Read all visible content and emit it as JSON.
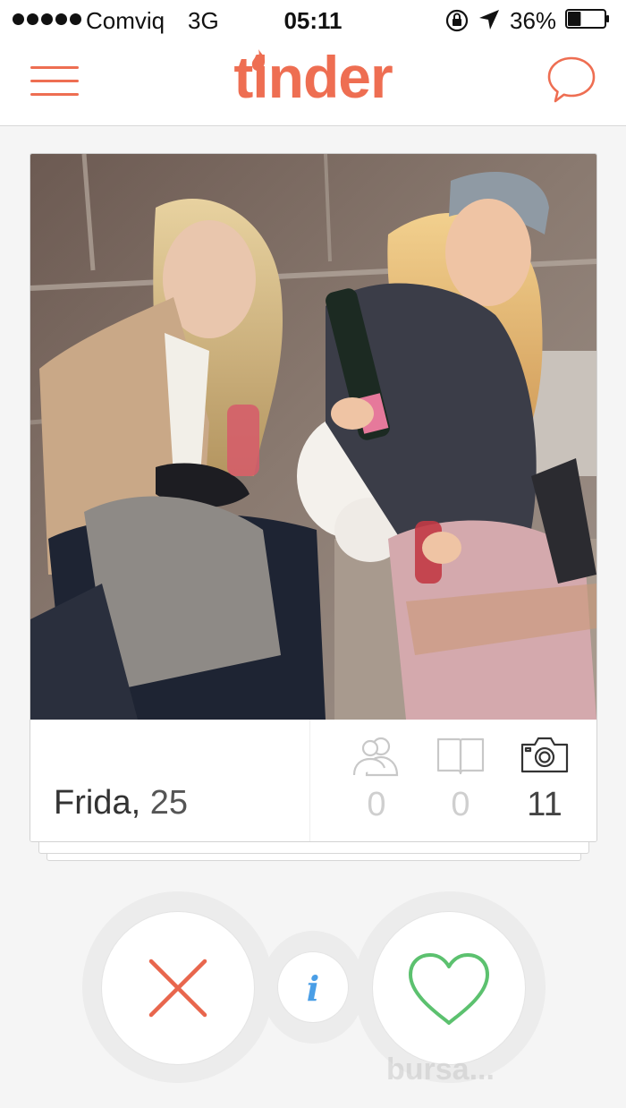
{
  "status_bar": {
    "carrier": "Comviq",
    "network": "3G",
    "time": "05:11",
    "battery_percent": "36%",
    "battery_level": 0.36,
    "icons": [
      "signal-dots-icon",
      "rotation-lock-icon",
      "location-arrow-icon",
      "battery-icon"
    ]
  },
  "nav": {
    "logo": "tinder",
    "menu_icon": "hamburger-menu-icon",
    "chat_icon": "chat-bubble-icon",
    "accent_color": "#ee6e52"
  },
  "card": {
    "name": "Frida,",
    "age": "25",
    "stats": {
      "shared_friends": "0",
      "shared_interests": "0",
      "photos": "11"
    },
    "stat_icons": [
      "friends-icon",
      "book-icon",
      "camera-icon"
    ],
    "photo_description_icon": "profile-photo"
  },
  "actions": {
    "nope_icon": "x-icon",
    "info_label": "i",
    "like_icon": "heart-icon",
    "nope_color": "#e8664d",
    "like_color": "#5cc16f",
    "info_color": "#4a9ee6"
  },
  "watermark": "bursa..."
}
